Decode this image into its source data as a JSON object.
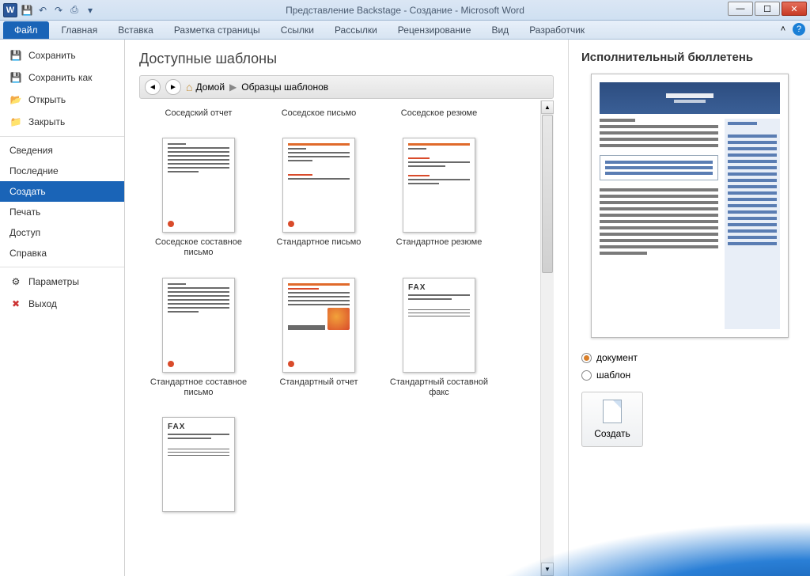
{
  "titlebar": {
    "title": "Представление Backstage - Создание  -  Microsoft Word",
    "word_glyph": "W"
  },
  "window_controls": {
    "min": "—",
    "max": "☐",
    "close": "✕"
  },
  "ribbon": {
    "file": "Файл",
    "tabs": [
      "Главная",
      "Вставка",
      "Разметка страницы",
      "Ссылки",
      "Рассылки",
      "Рецензирование",
      "Вид",
      "Разработчик"
    ],
    "minimize_glyph": "˄",
    "help_glyph": "?"
  },
  "backstage_nav": {
    "save": "Сохранить",
    "save_as": "Сохранить как",
    "open": "Открыть",
    "close": "Закрыть",
    "info": "Сведения",
    "recent": "Последние",
    "new": "Создать",
    "print": "Печать",
    "share": "Доступ",
    "help": "Справка",
    "options": "Параметры",
    "exit": "Выход"
  },
  "templates": {
    "heading": "Доступные шаблоны",
    "breadcrumb": {
      "back": "◄",
      "forward": "►",
      "home_icon": "⌂",
      "home": "Домой",
      "sep": "▶",
      "current": "Образцы шаблонов"
    },
    "items": [
      {
        "label": "Соседский отчет",
        "partial": true
      },
      {
        "label": "Соседское письмо",
        "partial": true
      },
      {
        "label": "Соседское резюме",
        "partial": true
      },
      {
        "label": "Соседское составное письмо",
        "style": "orange-lines-dot"
      },
      {
        "label": "Стандартное письмо",
        "style": "orange-bar-dot"
      },
      {
        "label": "Стандартное резюме",
        "style": "orange-bar-clean"
      },
      {
        "label": "Стандартное составное письмо",
        "style": "orange-lines-dot"
      },
      {
        "label": "Стандартный отчет",
        "style": "orange-bar-img"
      },
      {
        "label": "Стандартный составной факс",
        "style": "fax"
      },
      {
        "label": "",
        "style": "fax",
        "trailing": true
      }
    ]
  },
  "preview": {
    "title": "Исполнительный бюллетень",
    "radio_document": "документ",
    "radio_template": "шаблон",
    "create": "Создать"
  }
}
